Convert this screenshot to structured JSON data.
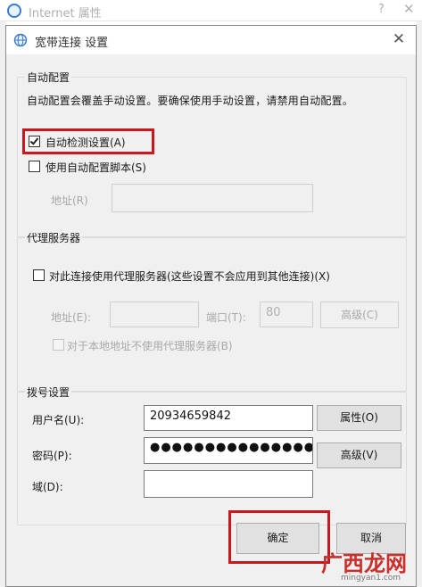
{
  "background_window": {
    "title": "Internet 属性",
    "help": "?",
    "close": "✕"
  },
  "dialog": {
    "title": "宽带连接 设置",
    "close": "✕"
  },
  "auto_config": {
    "legend": "自动配置",
    "description": "自动配置会覆盖手动设置。要确保使用手动设置，请禁用自动配置。",
    "auto_detect_label": "自动检测设置(A)",
    "auto_detect_checked": true,
    "use_script_label": "使用自动配置脚本(S)",
    "use_script_checked": false,
    "address_label": "地址(R)",
    "address_value": ""
  },
  "proxy": {
    "legend": "代理服务器",
    "use_proxy_label": "对此连接使用代理服务器(这些设置不会应用到其他连接)(X)",
    "use_proxy_checked": false,
    "address_label": "地址(E):",
    "address_value": "",
    "port_label": "端口(T):",
    "port_value": "80",
    "advanced_label": "高级(C)",
    "bypass_label": "对于本地地址不使用代理服务器(B)",
    "bypass_checked": false
  },
  "dialup": {
    "legend": "拨号设置",
    "username_label": "用户名(U):",
    "username_value": "20934659842",
    "password_label": "密码(P):",
    "password_value": "●●●●●●●●●●●●●●●●",
    "domain_label": "域(D):",
    "domain_value": "",
    "properties_label": "属性(O)",
    "advanced_label": "高级(V)"
  },
  "footer": {
    "ok_label": "确定",
    "cancel_label": "取消"
  },
  "watermark": {
    "logo_text": "广西龙网",
    "site_text": "mingyan1.com"
  },
  "colors": {
    "highlight": "#c8171e",
    "dialog_bg": "#f0f0f0"
  }
}
